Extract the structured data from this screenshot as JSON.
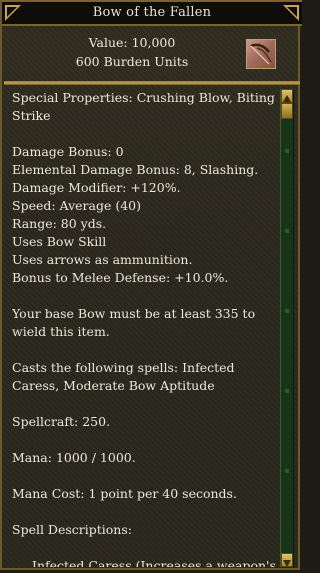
{
  "window": {
    "title": "Bow of the Fallen"
  },
  "header": {
    "value": "Value: 10,000",
    "burden": "600 Burden Units",
    "icon": "bow-item-icon"
  },
  "description": {
    "special": "Special Properties: Crushing Blow, Biting Strike",
    "damage_bonus": "Damage Bonus: 0",
    "elemental_bonus": "Elemental Damage Bonus: 8, Slashing.",
    "damage_modifier": "Damage Modifier: +120%.",
    "speed": "Speed: Average (40)",
    "range": "Range: 80 yds.",
    "skill": "Uses Bow Skill",
    "ammo": "Uses arrows as ammunition.",
    "melee_defense": "Bonus to Melee Defense: +10.0%.",
    "wield_req": "Your base Bow must be at least 335 to wield this item.",
    "casts": "Casts the following spells: Infected Caress, Moderate Bow Aptitude",
    "spellcraft": "Spellcraft: 250.",
    "mana": "Mana: 1000 / 1000.",
    "mana_cost": "Mana Cost: 1 point per 40 seconds.",
    "spell_desc_header": "Spell Descriptions:",
    "spell_desc_1": "Infected Caress (Increases a weapon's"
  },
  "scrollbar": {
    "position": 0.0
  },
  "colors": {
    "title_bg": "#0e0d0a",
    "gold_border": "#c8a64e",
    "text": "#ece8da",
    "scroll_track": "#173318"
  }
}
